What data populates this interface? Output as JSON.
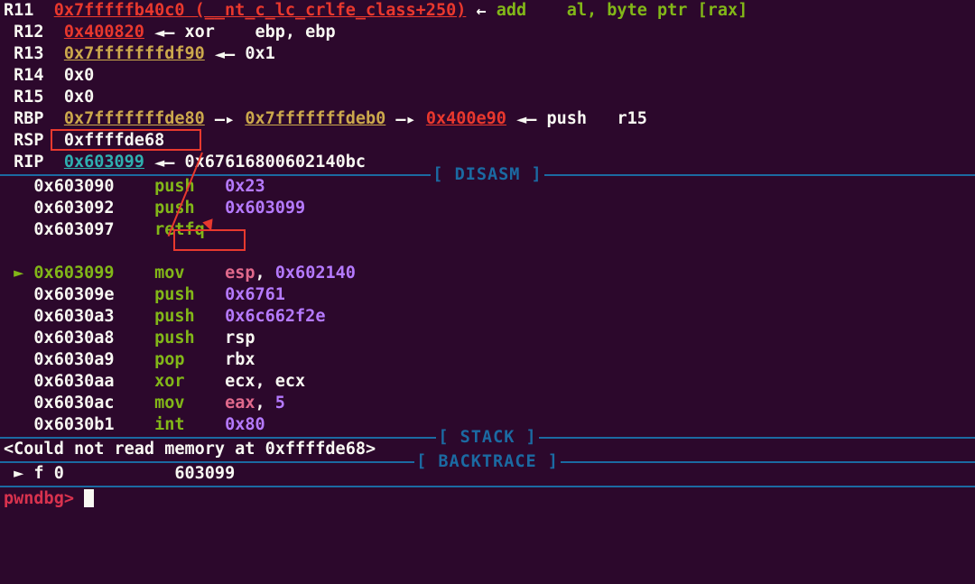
{
  "registers": {
    "r11": {
      "name": "R11",
      "val": "0x7fffffb40c0 (__nt_c_lc_crlfe_class+250)",
      "arrow": "←",
      "asm": "add    al, byte ptr [rax]"
    },
    "r12": {
      "name": "R12",
      "val": "0x400820",
      "arrow": "◄—",
      "asm": "xor    ebp, ebp"
    },
    "r13": {
      "name": "R13",
      "val": "0x7fffffffdf90",
      "arrow": "◄—",
      "asm": "0x1"
    },
    "r14": {
      "name": "R14",
      "val": "0x0"
    },
    "r15": {
      "name": "R15",
      "val": "0x0"
    },
    "rbp": {
      "name": "RBP",
      "val": "0x7fffffffde80",
      "arrow": "—▸",
      "val2": "0x7fffffffdeb0",
      "arrow2": "—▸",
      "val3": "0x400e90",
      "arrow3": "◄—",
      "asm": "push   r15"
    },
    "rsp": {
      "name": "RSP",
      "val": "0xffffde68"
    },
    "rip": {
      "name": "RIP",
      "val": "0x603099",
      "arrow": "◄—",
      "asm": "0x67616800602140bc"
    }
  },
  "sections": {
    "disasm": "[ DISASM ]",
    "stack": "[ STACK ]",
    "backtrace": "[ BACKTRACE ]"
  },
  "disasm": {
    "l1": {
      "addr": "0x603090",
      "op": "push",
      "arg": "0x23"
    },
    "l2": {
      "addr": "0x603092",
      "op": "push",
      "arg": "0x603099"
    },
    "l3": {
      "addr": "0x603097",
      "op": "retfq"
    },
    "cur": {
      "addr": "0x603099",
      "op": "mov",
      "arg": "esp, 0x602140",
      "esp": "esp",
      "comma": ", ",
      "imm": "0x602140"
    },
    "l4": {
      "addr": "0x60309e",
      "op": "push",
      "arg": "0x6761"
    },
    "l5": {
      "addr": "0x6030a3",
      "op": "push",
      "arg": "0x6c662f2e"
    },
    "l6": {
      "addr": "0x6030a8",
      "op": "push",
      "arg": "rsp"
    },
    "l7": {
      "addr": "0x6030a9",
      "op": "pop",
      "arg": "rbx"
    },
    "l8": {
      "addr": "0x6030aa",
      "op": "xor",
      "arg": "ecx, ecx"
    },
    "l9": {
      "addr": "0x6030ac",
      "op": "mov",
      "arg": "eax, 5",
      "eax": "eax",
      "comma": ", ",
      "imm": "5"
    },
    "l10": {
      "addr": "0x6030b1",
      "op": "int",
      "arg": "0x80"
    }
  },
  "stack_msg": "<Could not read memory at 0xffffde68>",
  "backtrace": {
    "marker": "► f 0",
    "addr": "603099"
  },
  "prompt": "pwndbg>"
}
